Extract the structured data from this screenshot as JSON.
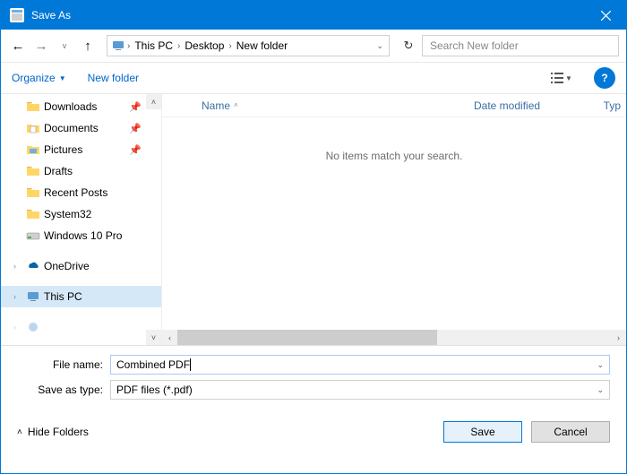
{
  "window": {
    "title": "Save As"
  },
  "breadcrumb": {
    "seg1": "This PC",
    "seg2": "Desktop",
    "seg3": "New folder"
  },
  "search": {
    "placeholder": "Search New folder"
  },
  "toolbar": {
    "organize": "Organize",
    "newfolder": "New folder"
  },
  "sidebar": {
    "items": [
      {
        "label": "Downloads",
        "pinned": true,
        "icon": "folder"
      },
      {
        "label": "Documents",
        "pinned": true,
        "icon": "documents"
      },
      {
        "label": "Pictures",
        "pinned": true,
        "icon": "pictures"
      },
      {
        "label": "Drafts",
        "pinned": false,
        "icon": "folder"
      },
      {
        "label": "Recent Posts",
        "pinned": false,
        "icon": "folder"
      },
      {
        "label": "System32",
        "pinned": false,
        "icon": "folder"
      },
      {
        "label": "Windows 10 Pro",
        "pinned": false,
        "icon": "drive"
      }
    ],
    "onedrive": "OneDrive",
    "thispc": "This PC"
  },
  "columns": {
    "name": "Name",
    "date": "Date modified",
    "type": "Typ"
  },
  "content": {
    "empty": "No items match your search."
  },
  "form": {
    "filename_label": "File name:",
    "filename_value": "Combined PDF",
    "savetype_label": "Save as type:",
    "savetype_value": "PDF files (*.pdf)"
  },
  "footer": {
    "hide": "Hide Folders",
    "save": "Save",
    "cancel": "Cancel"
  }
}
